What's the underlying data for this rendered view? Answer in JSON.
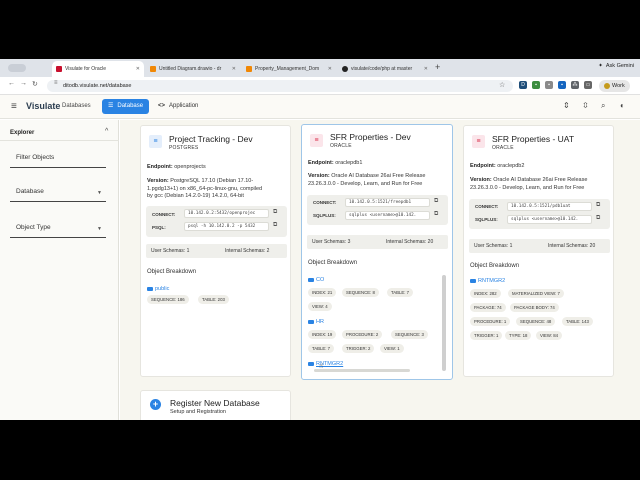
{
  "browser": {
    "tabs": [
      {
        "title": "Visulate for Oracle",
        "active": true,
        "color": "#c8102e"
      },
      {
        "title": "Untitled Diagram.drawio - dr",
        "active": false,
        "color": "#f08705"
      },
      {
        "title": "Property_Management_Dom",
        "active": false,
        "color": "#f08705"
      },
      {
        "title": "visulate/code/php at master",
        "active": false,
        "color": "#222222"
      }
    ],
    "ask_label": "Ask Gemini",
    "url": "ditodb.visulate.net/database",
    "profile_label": "Work"
  },
  "app": {
    "title": "Visulate",
    "nav_label": "Databases",
    "tabs": [
      {
        "label": "Database",
        "icon": "database-icon",
        "active": true
      },
      {
        "label": "Application",
        "icon": "code-icon",
        "active": false
      }
    ],
    "accent": "#2a83e3"
  },
  "sidebar": {
    "title": "Explorer",
    "filter_placeholder": "Filter Objects",
    "database_label": "Database",
    "object_type_label": "Object Type"
  },
  "cards": [
    {
      "title": "Project Tracking - Dev",
      "type": "POSTGRES",
      "endpoint_label": "Endpoint:",
      "endpoint": "openprojects",
      "version_label": "Version:",
      "version_lines": [
        "PostgreSQL 17.10 (Debian 17.10-",
        "1.pgdg13+1) on x86_64-pc-linux-gnu, compiled",
        "by gcc (Debian 14.2.0-19) 14.2.0, 64-bit"
      ],
      "connect_label": "CONNECT:",
      "connect_value": "10.142.0.2:5432/openprojec",
      "cli_label": "PSQL:",
      "cli_value": "psql -h 10.142.0.2 -p 5432",
      "user_schemas": "User Schemas: 1",
      "internal_schemas": "Internal Schemas: 2",
      "breakdown_title": "Object Breakdown",
      "schemas": [
        {
          "name": "public",
          "chips": [
            "SEQUENCE: 186",
            "TABLE: 203"
          ]
        }
      ]
    },
    {
      "title": "SFR Properties - Dev",
      "type": "ORACLE",
      "endpoint_label": "Endpoint:",
      "endpoint": "oraclepdb1",
      "version_label": "Version:",
      "version_lines": [
        "Oracle AI Database 26ai Free Release",
        "23.26.3.0.0 - Develop, Learn, and Run for Free"
      ],
      "connect_label": "CONNECT:",
      "connect_value": "10.142.0.5:1521/freepdb1",
      "cli_label": "SQLPLUS:",
      "cli_value": "sqlplus <username>@10.142.",
      "user_schemas": "User Schemas: 3",
      "internal_schemas": "Internal Schemas: 20",
      "breakdown_title": "Object Breakdown",
      "schemas": [
        {
          "name": "CO",
          "chips": [
            "INDEX: 21",
            "SEQUENCE: 8",
            "TABLE: 7",
            "VIEW: 4"
          ]
        },
        {
          "name": "HR",
          "chips": [
            "INDEX: 19",
            "PROCEDURE: 2",
            "SEQUENCE: 3",
            "TABLE: 7",
            "TRIGGER: 2",
            "VIEW: 1"
          ]
        },
        {
          "name": "RNTMGR2",
          "chips": []
        }
      ]
    },
    {
      "title": "SFR Properties - UAT",
      "type": "ORACLE",
      "endpoint_label": "Endpoint:",
      "endpoint": "oraclepdb2",
      "version_label": "Version:",
      "version_lines": [
        "Oracle AI Database 26ai Free Release",
        "23.26.3.0.0 - Develop, Learn, and Run for Free"
      ],
      "connect_label": "CONNECT:",
      "connect_value": "10.142.0.5:1521/pdb1uat",
      "cli_label": "SQLPLUS:",
      "cli_value": "sqlplus <username>@10.142.",
      "user_schemas": "User Schemas: 1",
      "internal_schemas": "Internal Schemas: 20",
      "breakdown_title": "Object Breakdown",
      "schemas": [
        {
          "name": "RNTMGR2",
          "chips": [
            "INDEX: 282",
            "MATERIALIZED VIEW: 7",
            "PACKAGE: 74",
            "PACKAGE BODY: 74",
            "PROCEDURE: 1",
            "SEQUENCE: 48",
            "TABLE: 143",
            "TRIGGER: 1",
            "TYPE: 18",
            "VIEW: 84"
          ]
        }
      ]
    }
  ],
  "register": {
    "title": "Register New Database",
    "subtitle": "Setup and Registration"
  }
}
